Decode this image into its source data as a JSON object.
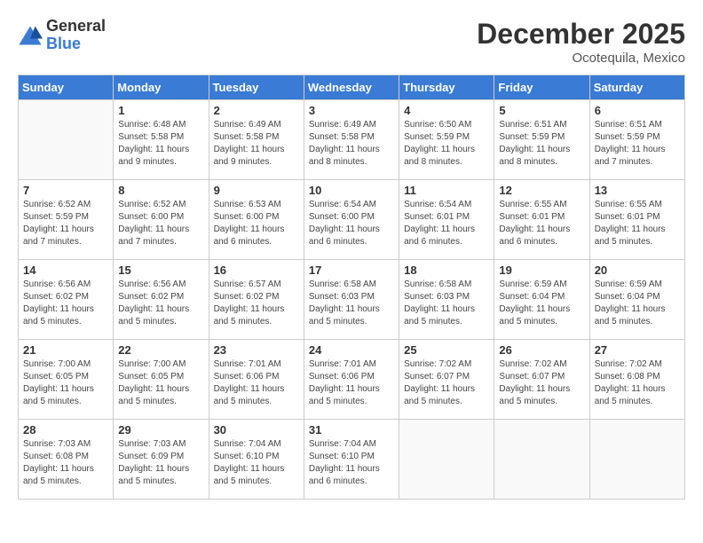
{
  "logo": {
    "general": "General",
    "blue": "Blue"
  },
  "header": {
    "month": "December 2025",
    "location": "Ocotequila, Mexico"
  },
  "weekdays": [
    "Sunday",
    "Monday",
    "Tuesday",
    "Wednesday",
    "Thursday",
    "Friday",
    "Saturday"
  ],
  "weeks": [
    [
      {
        "day": "",
        "info": ""
      },
      {
        "day": "1",
        "info": "Sunrise: 6:48 AM\nSunset: 5:58 PM\nDaylight: 11 hours\nand 9 minutes."
      },
      {
        "day": "2",
        "info": "Sunrise: 6:49 AM\nSunset: 5:58 PM\nDaylight: 11 hours\nand 9 minutes."
      },
      {
        "day": "3",
        "info": "Sunrise: 6:49 AM\nSunset: 5:58 PM\nDaylight: 11 hours\nand 8 minutes."
      },
      {
        "day": "4",
        "info": "Sunrise: 6:50 AM\nSunset: 5:59 PM\nDaylight: 11 hours\nand 8 minutes."
      },
      {
        "day": "5",
        "info": "Sunrise: 6:51 AM\nSunset: 5:59 PM\nDaylight: 11 hours\nand 8 minutes."
      },
      {
        "day": "6",
        "info": "Sunrise: 6:51 AM\nSunset: 5:59 PM\nDaylight: 11 hours\nand 7 minutes."
      }
    ],
    [
      {
        "day": "7",
        "info": "Sunrise: 6:52 AM\nSunset: 5:59 PM\nDaylight: 11 hours\nand 7 minutes."
      },
      {
        "day": "8",
        "info": "Sunrise: 6:52 AM\nSunset: 6:00 PM\nDaylight: 11 hours\nand 7 minutes."
      },
      {
        "day": "9",
        "info": "Sunrise: 6:53 AM\nSunset: 6:00 PM\nDaylight: 11 hours\nand 6 minutes."
      },
      {
        "day": "10",
        "info": "Sunrise: 6:54 AM\nSunset: 6:00 PM\nDaylight: 11 hours\nand 6 minutes."
      },
      {
        "day": "11",
        "info": "Sunrise: 6:54 AM\nSunset: 6:01 PM\nDaylight: 11 hours\nand 6 minutes."
      },
      {
        "day": "12",
        "info": "Sunrise: 6:55 AM\nSunset: 6:01 PM\nDaylight: 11 hours\nand 6 minutes."
      },
      {
        "day": "13",
        "info": "Sunrise: 6:55 AM\nSunset: 6:01 PM\nDaylight: 11 hours\nand 5 minutes."
      }
    ],
    [
      {
        "day": "14",
        "info": "Sunrise: 6:56 AM\nSunset: 6:02 PM\nDaylight: 11 hours\nand 5 minutes."
      },
      {
        "day": "15",
        "info": "Sunrise: 6:56 AM\nSunset: 6:02 PM\nDaylight: 11 hours\nand 5 minutes."
      },
      {
        "day": "16",
        "info": "Sunrise: 6:57 AM\nSunset: 6:02 PM\nDaylight: 11 hours\nand 5 minutes."
      },
      {
        "day": "17",
        "info": "Sunrise: 6:58 AM\nSunset: 6:03 PM\nDaylight: 11 hours\nand 5 minutes."
      },
      {
        "day": "18",
        "info": "Sunrise: 6:58 AM\nSunset: 6:03 PM\nDaylight: 11 hours\nand 5 minutes."
      },
      {
        "day": "19",
        "info": "Sunrise: 6:59 AM\nSunset: 6:04 PM\nDaylight: 11 hours\nand 5 minutes."
      },
      {
        "day": "20",
        "info": "Sunrise: 6:59 AM\nSunset: 6:04 PM\nDaylight: 11 hours\nand 5 minutes."
      }
    ],
    [
      {
        "day": "21",
        "info": "Sunrise: 7:00 AM\nSunset: 6:05 PM\nDaylight: 11 hours\nand 5 minutes."
      },
      {
        "day": "22",
        "info": "Sunrise: 7:00 AM\nSunset: 6:05 PM\nDaylight: 11 hours\nand 5 minutes."
      },
      {
        "day": "23",
        "info": "Sunrise: 7:01 AM\nSunset: 6:06 PM\nDaylight: 11 hours\nand 5 minutes."
      },
      {
        "day": "24",
        "info": "Sunrise: 7:01 AM\nSunset: 6:06 PM\nDaylight: 11 hours\nand 5 minutes."
      },
      {
        "day": "25",
        "info": "Sunrise: 7:02 AM\nSunset: 6:07 PM\nDaylight: 11 hours\nand 5 minutes."
      },
      {
        "day": "26",
        "info": "Sunrise: 7:02 AM\nSunset: 6:07 PM\nDaylight: 11 hours\nand 5 minutes."
      },
      {
        "day": "27",
        "info": "Sunrise: 7:02 AM\nSunset: 6:08 PM\nDaylight: 11 hours\nand 5 minutes."
      }
    ],
    [
      {
        "day": "28",
        "info": "Sunrise: 7:03 AM\nSunset: 6:08 PM\nDaylight: 11 hours\nand 5 minutes."
      },
      {
        "day": "29",
        "info": "Sunrise: 7:03 AM\nSunset: 6:09 PM\nDaylight: 11 hours\nand 5 minutes."
      },
      {
        "day": "30",
        "info": "Sunrise: 7:04 AM\nSunset: 6:10 PM\nDaylight: 11 hours\nand 5 minutes."
      },
      {
        "day": "31",
        "info": "Sunrise: 7:04 AM\nSunset: 6:10 PM\nDaylight: 11 hours\nand 6 minutes."
      },
      {
        "day": "",
        "info": ""
      },
      {
        "day": "",
        "info": ""
      },
      {
        "day": "",
        "info": ""
      }
    ]
  ]
}
